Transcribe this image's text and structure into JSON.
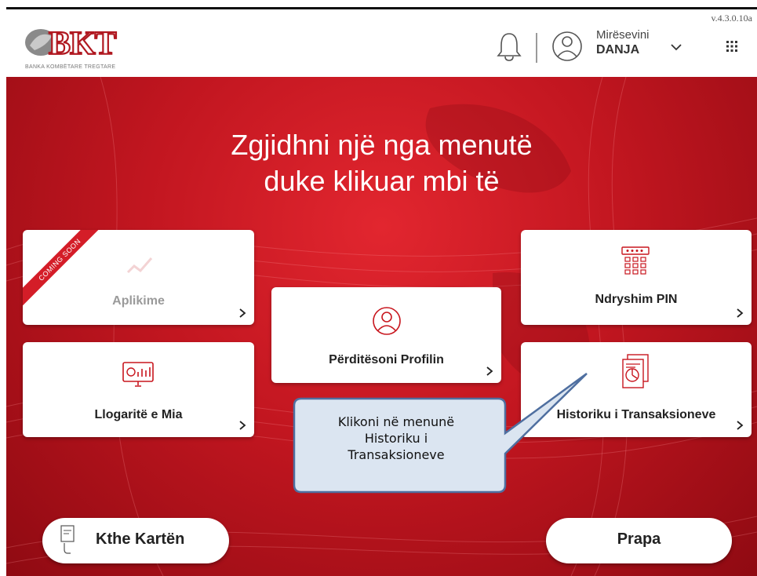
{
  "header": {
    "logo_text": "BKT",
    "logo_subtitle": "BANKA KOMBËTARE TREGTARE",
    "version": "v.4.3.0.10a",
    "greeting": "Mirësevini",
    "username": "DANJA"
  },
  "main": {
    "title_line1": "Zgjidhni një nga menutë",
    "title_line2": "duke klikuar mbi të",
    "menu": {
      "aplikime": {
        "label": "Aplikime",
        "badge": "COMING SOON"
      },
      "llogarite": {
        "label": "Llogaritë e Mia"
      },
      "profili": {
        "label": "Përditësoni Profilin"
      },
      "pin": {
        "label": "Ndryshim PIN"
      },
      "historiku": {
        "label": "Historiku i Transaksioneve"
      }
    },
    "return_card_label": "Kthe Kartën",
    "back_label": "Prapa"
  },
  "callout": {
    "line1": "Klikoni në menunë",
    "line2": "Historiku i",
    "line3": "Transaksioneve"
  },
  "colors": {
    "brand_red": "#c8161e",
    "callout_fill": "#dbe5f1",
    "callout_border": "#4f6fa0"
  }
}
